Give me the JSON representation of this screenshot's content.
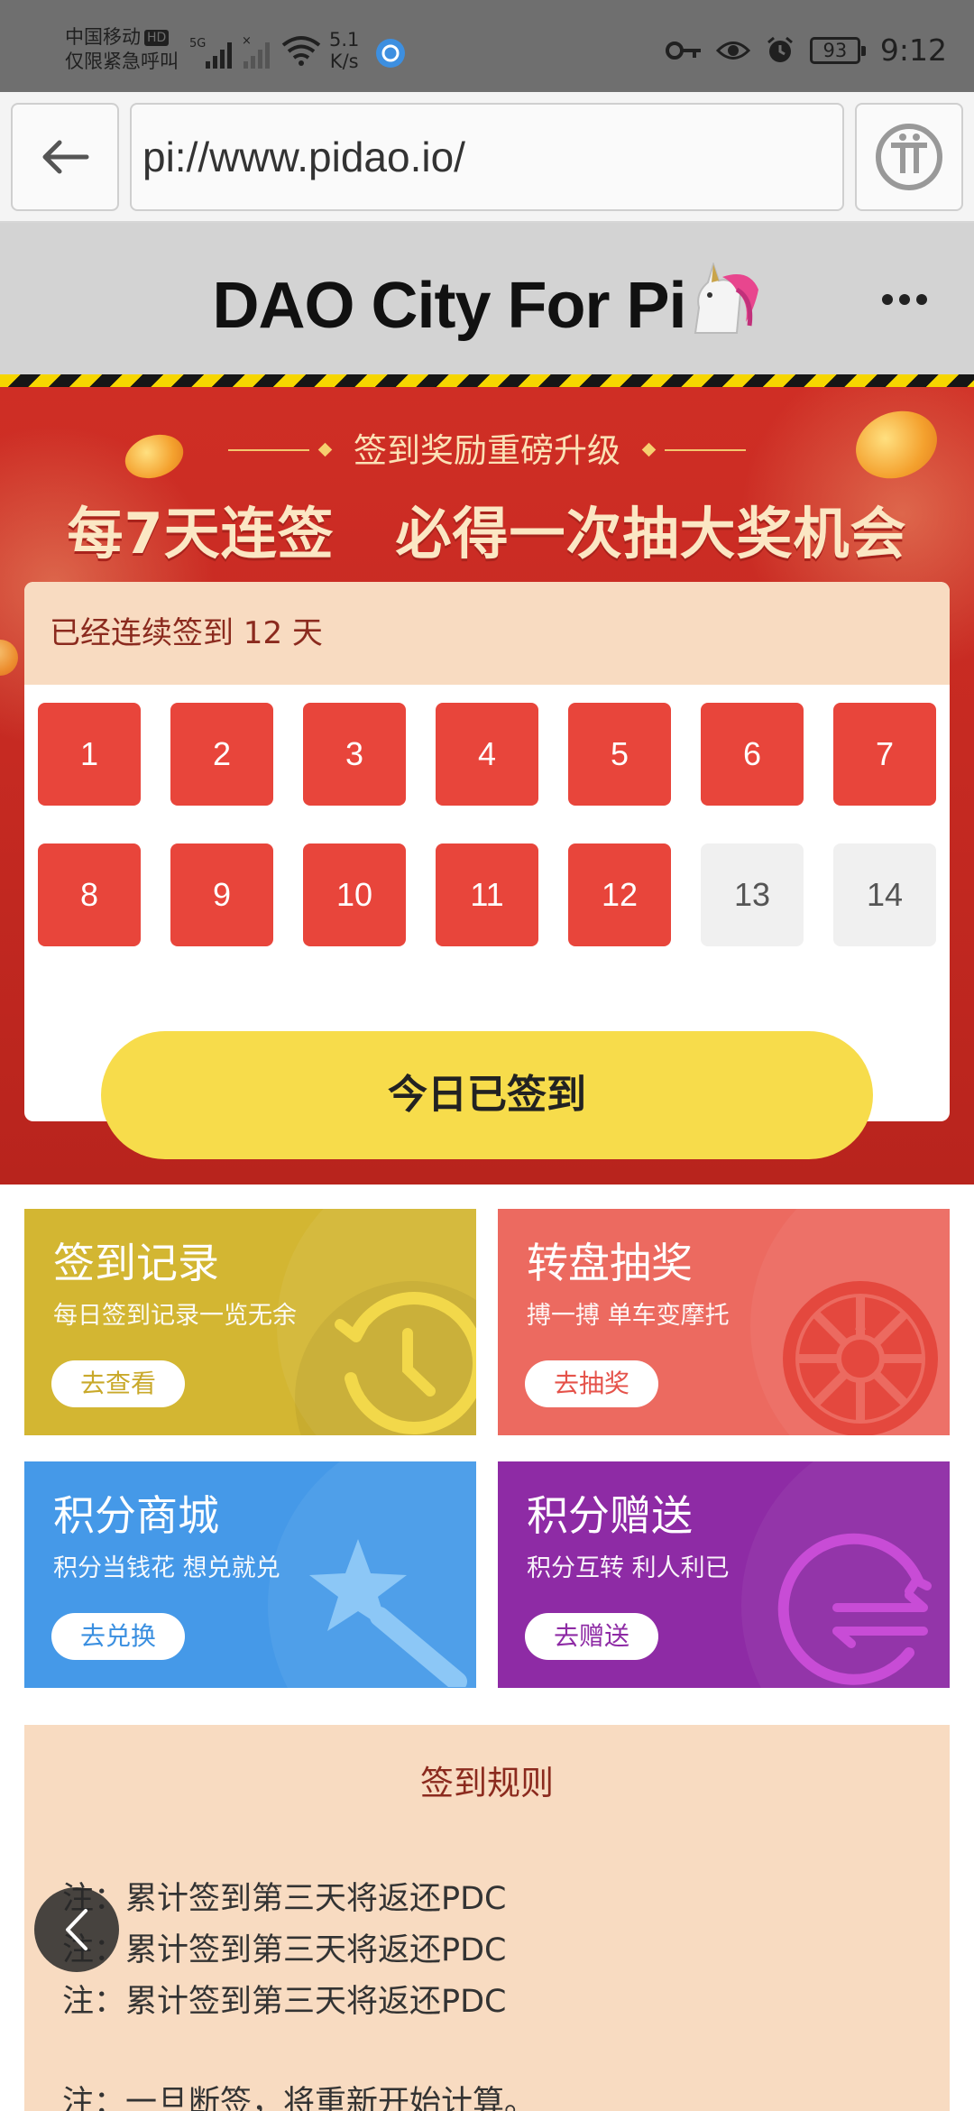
{
  "status_bar": {
    "carrier": "中国移动",
    "hd": "HD",
    "emergency": "仅限紧急呼叫",
    "network": "5G",
    "speed_value": "5.1",
    "speed_unit": "K/s",
    "battery": "93",
    "time": "9:12"
  },
  "browser": {
    "url": "pi://www.pidao.io/"
  },
  "header": {
    "title": "DAO City For Pi"
  },
  "banner": {
    "subhead": "签到奖励重磅升级",
    "headline": "每7天连签   必得一次抽大奖机会"
  },
  "checkin": {
    "streak_text": "已经连续签到 12 天",
    "days": [
      {
        "label": "1",
        "checked": true
      },
      {
        "label": "2",
        "checked": true
      },
      {
        "label": "3",
        "checked": true
      },
      {
        "label": "4",
        "checked": true
      },
      {
        "label": "5",
        "checked": true
      },
      {
        "label": "6",
        "checked": true
      },
      {
        "label": "7",
        "checked": true
      },
      {
        "label": "8",
        "checked": true
      },
      {
        "label": "9",
        "checked": true
      },
      {
        "label": "10",
        "checked": true
      },
      {
        "label": "11",
        "checked": true
      },
      {
        "label": "12",
        "checked": true
      },
      {
        "label": "13",
        "checked": false
      },
      {
        "label": "14",
        "checked": false
      }
    ],
    "button_label": "今日已签到"
  },
  "tiles": [
    {
      "title": "签到记录",
      "subtitle": "每日签到记录一览无余",
      "button": "去查看",
      "color": "#d3b632",
      "icon": "history-clock-icon"
    },
    {
      "title": "转盘抽奖",
      "subtitle": "搏一搏 单车变摩托",
      "button": "去抽奖",
      "color": "#ec6a60",
      "icon": "prize-wheel-icon"
    },
    {
      "title": "积分商城",
      "subtitle": "积分当钱花 想兑就兑",
      "button": "去兑换",
      "color": "#4599e8",
      "icon": "magic-wand-icon"
    },
    {
      "title": "积分赠送",
      "subtitle": "积分互转 利人利已",
      "button": "去赠送",
      "color": "#8e2ba5",
      "icon": "transfer-arrows-icon"
    }
  ],
  "rules": {
    "title": "签到规则",
    "items": [
      "注：累计签到第三天将返还PDC",
      "注：累计签到第三天将返还PDC",
      "注：累计签到第三天将返还PDC",
      "注：一旦断签，将重新开始计算。"
    ]
  }
}
